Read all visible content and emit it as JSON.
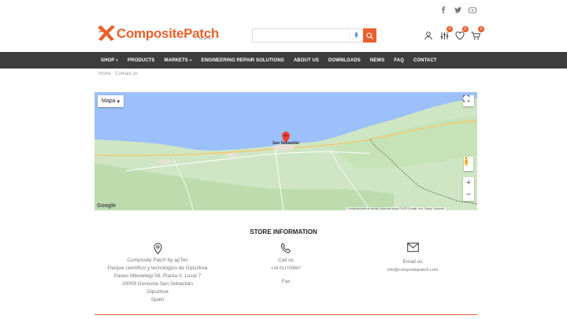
{
  "brand": {
    "name": "CompositePatch",
    "tagline": "by apTec",
    "accent": "#e8602c"
  },
  "search": {
    "placeholder": ""
  },
  "header_badges": {
    "compare": "0",
    "wishlist": "0",
    "cart": "0"
  },
  "nav": {
    "items": [
      "SHOP",
      "PRODUCTS",
      "MARKETS",
      "ENGINEERING REPAIR SOLUTIONS",
      "ABOUT US",
      "DOWNLOADS",
      "NEWS",
      "FAQ",
      "CONTACT"
    ]
  },
  "breadcrumb": [
    "Home",
    "Contact us"
  ],
  "map": {
    "type_button": "Mapa",
    "city": "San Sebastián",
    "attribution": "Combinaciones de teclas   Datos del mapa ©2023 Google, Inst. Geogr. Nacional",
    "google": "Google"
  },
  "store": {
    "title": "STORE INFORMATION",
    "address_lines": [
      "Composite Patch by apTec",
      "Parque científico y tecnológico de Gipuzkoa",
      "Paseo Mikeletegi 58, Planta 0, Local 7",
      "20009 Donostia-San Sebastián",
      "Gipuzkoa",
      "Spain"
    ],
    "call_label": "Call us",
    "phone": "+34 611700807",
    "fax_label": "Fax",
    "email_label": "Email us",
    "email": "info@compositepatch.com"
  }
}
